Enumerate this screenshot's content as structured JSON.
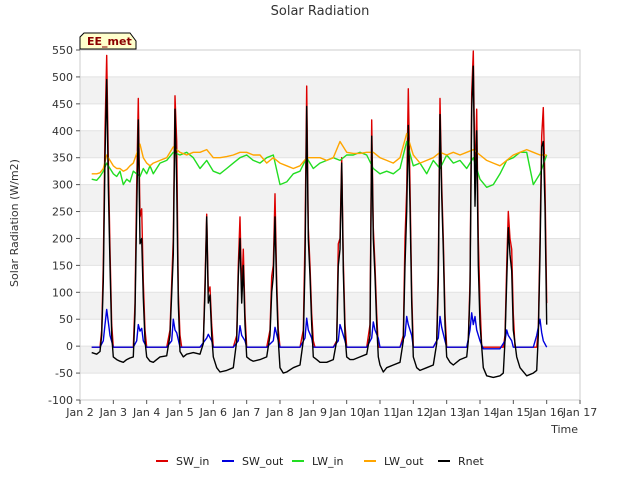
{
  "chart_data": {
    "type": "line",
    "title": "Solar Radiation",
    "xlabel": "Time",
    "ylabel": "Solar Radiation (W/m2)",
    "badge": "EE_met",
    "x_range": [
      2,
      17
    ],
    "ylim": [
      -100,
      550
    ],
    "x_ticks": [
      {
        "v": 2,
        "label": "Jan 2"
      },
      {
        "v": 3,
        "label": "Jan 3"
      },
      {
        "v": 4,
        "label": "Jan 4"
      },
      {
        "v": 5,
        "label": "Jan 5"
      },
      {
        "v": 6,
        "label": "Jan 6"
      },
      {
        "v": 7,
        "label": "Jan 7"
      },
      {
        "v": 8,
        "label": "Jan 8"
      },
      {
        "v": 9,
        "label": "Jan 9"
      },
      {
        "v": 10,
        "label": "Jan 10"
      },
      {
        "v": 11,
        "label": "Jan 11"
      },
      {
        "v": 12,
        "label": "Jan 12"
      },
      {
        "v": 13,
        "label": "Jan 13"
      },
      {
        "v": 14,
        "label": "Jan 14"
      },
      {
        "v": 15,
        "label": "Jan 15"
      },
      {
        "v": 16,
        "label": "Jan 16"
      },
      {
        "v": 17,
        "label": "Jan 17"
      }
    ],
    "y_ticks": [
      -100,
      -50,
      0,
      50,
      100,
      150,
      200,
      250,
      300,
      350,
      400,
      450,
      500,
      550
    ],
    "grid": "horizontal bands",
    "legend_position": "bottom",
    "series": [
      {
        "name": "SW_in",
        "color": "#dd0000",
        "x": [
          2.35,
          2.6,
          2.65,
          2.7,
          2.75,
          2.8,
          2.85,
          2.9,
          2.95,
          3.0,
          3.05,
          3.1,
          3.15,
          3.2,
          3.25,
          3.3,
          3.35,
          3.4,
          3.6,
          3.65,
          3.7,
          3.75,
          3.8,
          3.85,
          3.9,
          3.95,
          4.0,
          4.05,
          4.1,
          4.15,
          4.2,
          4.25,
          4.3,
          4.35,
          4.6,
          4.7,
          4.8,
          4.85,
          4.9,
          4.95,
          5.0,
          5.05,
          5.1,
          5.15,
          5.2,
          5.3,
          5.6,
          5.7,
          5.75,
          5.8,
          5.85,
          5.9,
          5.95,
          6.0,
          6.05,
          6.1,
          6.2,
          6.6,
          6.7,
          6.75,
          6.8,
          6.85,
          6.9,
          6.95,
          7.0,
          7.05,
          7.1,
          7.2,
          7.6,
          7.7,
          7.75,
          7.8,
          7.85,
          7.9,
          7.95,
          8.0,
          8.05,
          8.1,
          8.2,
          8.6,
          8.7,
          8.75,
          8.8,
          8.85,
          8.9,
          8.95,
          9.0,
          9.05,
          9.1,
          9.2,
          9.6,
          9.7,
          9.75,
          9.8,
          9.85,
          9.9,
          9.95,
          10.0,
          10.05,
          10.1,
          10.2,
          10.6,
          10.7,
          10.75,
          10.8,
          10.85,
          10.9,
          10.95,
          11.0,
          11.05,
          11.1,
          11.2,
          11.6,
          11.7,
          11.75,
          11.8,
          11.85,
          11.9,
          11.95,
          12.0,
          12.05,
          12.1,
          12.2,
          12.6,
          12.7,
          12.75,
          12.8,
          12.85,
          12.9,
          12.95,
          13.0,
          13.05,
          13.1,
          13.2,
          13.6,
          13.65,
          13.7,
          13.75,
          13.8,
          13.85,
          13.9,
          13.95,
          14.0,
          14.05,
          14.1,
          14.2,
          14.6,
          14.7,
          14.75,
          14.8,
          14.85,
          14.9,
          14.95,
          15.0,
          15.05,
          15.1,
          15.2,
          15.6,
          15.7,
          15.75,
          15.8,
          15.85,
          15.9,
          15.95,
          16.0
        ],
        "y": [
          -2,
          -2,
          30,
          150,
          400,
          540,
          350,
          180,
          40,
          -2,
          -2,
          -2,
          -2,
          -2,
          -2,
          -2,
          -2,
          -2,
          -2,
          80,
          300,
          460,
          240,
          255,
          120,
          30,
          -2,
          -2,
          -2,
          -2,
          -2,
          -2,
          -2,
          -2,
          -2,
          30,
          200,
          465,
          380,
          100,
          20,
          -2,
          -2,
          -2,
          -2,
          -2,
          -2,
          5,
          120,
          245,
          100,
          110,
          40,
          -2,
          -2,
          -2,
          -2,
          -2,
          20,
          150,
          240,
          100,
          180,
          60,
          -2,
          -2,
          -2,
          -2,
          -2,
          30,
          130,
          150,
          283,
          120,
          30,
          -2,
          -2,
          -2,
          -2,
          -2,
          30,
          200,
          483,
          220,
          150,
          60,
          10,
          -2,
          -2,
          -2,
          -2,
          10,
          190,
          200,
          350,
          160,
          40,
          -2,
          -2,
          -2,
          -2,
          -2,
          40,
          420,
          220,
          150,
          60,
          -2,
          -2,
          -2,
          -2,
          -2,
          -2,
          20,
          200,
          290,
          478,
          300,
          100,
          -2,
          -2,
          -2,
          -2,
          -2,
          10,
          150,
          460,
          300,
          200,
          60,
          -2,
          -2,
          -2,
          -2,
          -2,
          10,
          120,
          470,
          548,
          300,
          440,
          200,
          80,
          -2,
          -2,
          -2,
          -2,
          -2,
          20,
          150,
          250,
          200,
          180,
          60,
          -2,
          -2,
          -2,
          -2,
          -2,
          30,
          200,
          390,
          443,
          300,
          80
        ]
      },
      {
        "name": "SW_out",
        "color": "#0000dd",
        "x": [
          2.35,
          2.6,
          2.7,
          2.75,
          2.8,
          2.85,
          2.9,
          3.0,
          3.6,
          3.7,
          3.75,
          3.8,
          3.85,
          3.9,
          4.0,
          4.6,
          4.75,
          4.8,
          4.85,
          4.9,
          5.0,
          5.6,
          5.8,
          5.85,
          5.95,
          6.0,
          6.6,
          6.75,
          6.8,
          6.85,
          6.95,
          7.0,
          7.6,
          7.8,
          7.85,
          7.95,
          8.0,
          8.6,
          8.75,
          8.8,
          8.85,
          8.95,
          9.0,
          9.6,
          9.75,
          9.8,
          9.85,
          9.95,
          10.0,
          10.6,
          10.75,
          10.8,
          10.85,
          10.95,
          11.0,
          11.6,
          11.75,
          11.8,
          11.85,
          11.95,
          12.0,
          12.6,
          12.75,
          12.8,
          12.85,
          12.95,
          13.0,
          13.6,
          13.7,
          13.75,
          13.8,
          13.85,
          13.9,
          14.0,
          14.1,
          14.6,
          14.75,
          14.8,
          14.85,
          14.95,
          15.0,
          15.6,
          15.7,
          15.75,
          15.8,
          15.85,
          15.9,
          16.0
        ],
        "y": [
          -2,
          -2,
          10,
          40,
          68,
          45,
          20,
          -2,
          -2,
          10,
          40,
          28,
          33,
          10,
          -2,
          -2,
          10,
          50,
          30,
          25,
          -2,
          -2,
          15,
          22,
          10,
          -2,
          -2,
          10,
          38,
          20,
          10,
          -2,
          -2,
          10,
          35,
          10,
          -2,
          -2,
          15,
          52,
          30,
          15,
          -2,
          -2,
          10,
          40,
          30,
          10,
          -2,
          -2,
          15,
          45,
          30,
          15,
          -2,
          -2,
          20,
          55,
          40,
          20,
          -2,
          -2,
          15,
          55,
          35,
          10,
          -2,
          -2,
          30,
          62,
          40,
          55,
          30,
          10,
          -5,
          -5,
          10,
          30,
          20,
          10,
          -2,
          -2,
          20,
          35,
          50,
          25,
          10,
          -2
        ]
      },
      {
        "name": "LW_in",
        "color": "#22dd22",
        "x": [
          2.35,
          2.5,
          2.6,
          2.7,
          2.8,
          2.9,
          3.0,
          3.1,
          3.2,
          3.3,
          3.4,
          3.5,
          3.6,
          3.7,
          3.8,
          3.9,
          4.0,
          4.1,
          4.2,
          4.4,
          4.6,
          4.8,
          5.0,
          5.2,
          5.4,
          5.6,
          5.8,
          6.0,
          6.2,
          6.4,
          6.6,
          6.8,
          7.0,
          7.2,
          7.4,
          7.6,
          7.8,
          8.0,
          8.2,
          8.4,
          8.6,
          8.8,
          9.0,
          9.2,
          9.4,
          9.6,
          9.8,
          10.0,
          10.2,
          10.4,
          10.6,
          10.8,
          11.0,
          11.2,
          11.4,
          11.6,
          11.8,
          12.0,
          12.2,
          12.4,
          12.6,
          12.8,
          13.0,
          13.2,
          13.4,
          13.6,
          13.8,
          14.0,
          14.2,
          14.4,
          14.6,
          14.8,
          15.0,
          15.2,
          15.4,
          15.6,
          15.8,
          16.0
        ],
        "y": [
          310,
          308,
          315,
          325,
          340,
          330,
          320,
          315,
          325,
          300,
          310,
          305,
          325,
          320,
          315,
          330,
          320,
          335,
          320,
          340,
          345,
          360,
          355,
          360,
          350,
          330,
          345,
          325,
          320,
          330,
          340,
          350,
          355,
          345,
          340,
          350,
          355,
          300,
          305,
          320,
          325,
          350,
          330,
          340,
          345,
          350,
          345,
          355,
          355,
          360,
          355,
          330,
          320,
          325,
          320,
          330,
          380,
          335,
          340,
          320,
          345,
          330,
          355,
          340,
          345,
          330,
          350,
          310,
          295,
          300,
          320,
          345,
          350,
          360,
          360,
          300,
          320,
          355
        ]
      },
      {
        "name": "LW_out",
        "color": "#ffa500",
        "x": [
          2.35,
          2.5,
          2.6,
          2.7,
          2.8,
          2.9,
          3.0,
          3.1,
          3.2,
          3.3,
          3.4,
          3.5,
          3.6,
          3.8,
          3.9,
          4.0,
          4.1,
          4.2,
          4.4,
          4.6,
          4.8,
          5.0,
          5.2,
          5.4,
          5.6,
          5.8,
          6.0,
          6.2,
          6.4,
          6.6,
          6.8,
          7.0,
          7.2,
          7.4,
          7.6,
          7.8,
          8.0,
          8.2,
          8.4,
          8.6,
          8.8,
          9.0,
          9.2,
          9.4,
          9.6,
          9.8,
          10.0,
          10.2,
          10.4,
          10.6,
          10.8,
          11.0,
          11.2,
          11.4,
          11.6,
          11.8,
          12.0,
          12.2,
          12.4,
          12.6,
          12.8,
          13.0,
          13.2,
          13.4,
          13.6,
          13.8,
          14.0,
          14.2,
          14.4,
          14.6,
          14.8,
          15.0,
          15.2,
          15.4,
          15.6,
          15.8,
          16.0
        ],
        "y": [
          320,
          320,
          322,
          330,
          355,
          345,
          335,
          330,
          330,
          325,
          328,
          335,
          340,
          375,
          350,
          340,
          335,
          340,
          345,
          350,
          370,
          360,
          355,
          360,
          360,
          365,
          350,
          350,
          352,
          355,
          360,
          360,
          355,
          355,
          340,
          350,
          340,
          335,
          330,
          335,
          350,
          350,
          350,
          345,
          350,
          380,
          360,
          358,
          358,
          360,
          360,
          350,
          345,
          340,
          350,
          395,
          355,
          340,
          345,
          350,
          360,
          355,
          360,
          355,
          360,
          365,
          355,
          345,
          340,
          335,
          345,
          355,
          360,
          365,
          360,
          355,
          355
        ]
      },
      {
        "name": "Rnet",
        "color": "#000000",
        "x": [
          2.35,
          2.5,
          2.6,
          2.65,
          2.7,
          2.75,
          2.8,
          2.85,
          2.9,
          2.95,
          3.0,
          3.1,
          3.2,
          3.3,
          3.4,
          3.5,
          3.6,
          3.65,
          3.7,
          3.75,
          3.8,
          3.85,
          3.9,
          3.95,
          4.0,
          4.1,
          4.2,
          4.3,
          4.4,
          4.6,
          4.7,
          4.8,
          4.85,
          4.9,
          4.95,
          5.0,
          5.1,
          5.2,
          5.4,
          5.6,
          5.7,
          5.75,
          5.8,
          5.85,
          5.9,
          5.95,
          6.0,
          6.1,
          6.2,
          6.4,
          6.6,
          6.7,
          6.75,
          6.8,
          6.85,
          6.9,
          6.95,
          7.0,
          7.1,
          7.2,
          7.4,
          7.6,
          7.7,
          7.75,
          7.8,
          7.85,
          7.9,
          7.95,
          8.0,
          8.1,
          8.2,
          8.4,
          8.6,
          8.7,
          8.75,
          8.8,
          8.85,
          8.9,
          8.95,
          9.0,
          9.1,
          9.2,
          9.4,
          9.6,
          9.7,
          9.75,
          9.8,
          9.85,
          9.9,
          9.95,
          10.0,
          10.1,
          10.2,
          10.4,
          10.6,
          10.7,
          10.75,
          10.8,
          10.85,
          10.9,
          10.95,
          11.0,
          11.1,
          11.2,
          11.4,
          11.6,
          11.7,
          11.75,
          11.8,
          11.85,
          11.9,
          11.95,
          12.0,
          12.1,
          12.2,
          12.4,
          12.6,
          12.7,
          12.75,
          12.8,
          12.85,
          12.9,
          12.95,
          13.0,
          13.1,
          13.2,
          13.4,
          13.6,
          13.65,
          13.7,
          13.75,
          13.8,
          13.85,
          13.9,
          13.95,
          14.0,
          14.1,
          14.2,
          14.4,
          14.6,
          14.7,
          14.75,
          14.8,
          14.85,
          14.9,
          14.95,
          15.0,
          15.1,
          15.2,
          15.4,
          15.6,
          15.7,
          15.75,
          15.8,
          15.85,
          15.9,
          15.95,
          16.0
        ],
        "y": [
          -12,
          -15,
          -10,
          20,
          120,
          350,
          495,
          300,
          150,
          20,
          -20,
          -25,
          -28,
          -30,
          -25,
          -22,
          -20,
          60,
          250,
          420,
          190,
          200,
          90,
          10,
          -20,
          -28,
          -30,
          -25,
          -20,
          -18,
          20,
          170,
          440,
          300,
          80,
          -10,
          -20,
          -15,
          -12,
          -15,
          5,
          100,
          240,
          80,
          95,
          20,
          -20,
          -40,
          -48,
          -45,
          -40,
          10,
          130,
          200,
          80,
          150,
          40,
          -20,
          -25,
          -28,
          -25,
          -20,
          20,
          100,
          130,
          240,
          100,
          10,
          -40,
          -50,
          -48,
          -40,
          -35,
          10,
          150,
          445,
          200,
          130,
          40,
          -20,
          -25,
          -30,
          -30,
          -25,
          10,
          150,
          180,
          340,
          140,
          20,
          -20,
          -25,
          -25,
          -20,
          -15,
          20,
          390,
          200,
          130,
          40,
          -20,
          -35,
          -48,
          -40,
          -35,
          -30,
          10,
          150,
          250,
          410,
          260,
          80,
          -20,
          -40,
          -45,
          -40,
          -35,
          5,
          120,
          430,
          280,
          180,
          40,
          -20,
          -30,
          -35,
          -25,
          -20,
          10,
          100,
          440,
          520,
          260,
          400,
          150,
          40,
          -40,
          -55,
          -58,
          -55,
          -50,
          10,
          120,
          220,
          170,
          140,
          30,
          -20,
          -40,
          -55,
          -50,
          -45,
          20,
          170,
          370,
          380,
          260,
          40
        ]
      }
    ]
  }
}
